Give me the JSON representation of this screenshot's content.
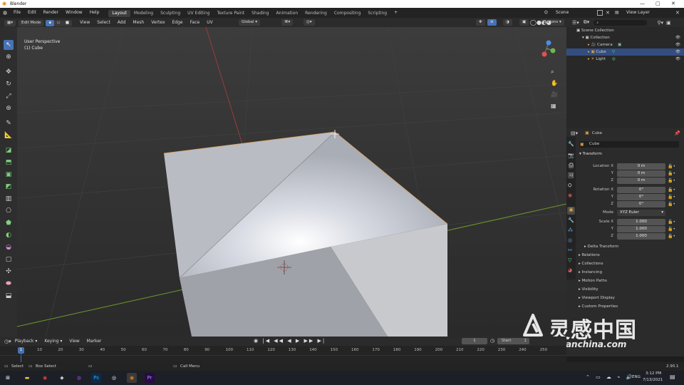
{
  "window": {
    "title": "Blender"
  },
  "menu": [
    "File",
    "Edit",
    "Render",
    "Window",
    "Help"
  ],
  "workspaces": [
    "Layout",
    "Modeling",
    "Sculpting",
    "UV Editing",
    "Texture Paint",
    "Shading",
    "Animation",
    "Rendering",
    "Compositing",
    "Scripting"
  ],
  "active_workspace": "Layout",
  "scene": {
    "label": "Scene",
    "view_layer": "View Layer"
  },
  "header": {
    "mode": "Edit Mode",
    "menus": [
      "View",
      "Select",
      "Add",
      "Mesh",
      "Vertex",
      "Edge",
      "Face",
      "UV"
    ],
    "orientation": "Global",
    "options": "Options"
  },
  "viewport": {
    "perspective": "User Perspective",
    "object": "(1) Cube"
  },
  "outliner": {
    "root": "Scene Collection",
    "collection": "Collection",
    "items": [
      "Camera",
      "Cube",
      "Light"
    ],
    "selected": "Cube",
    "search_placeholder": ""
  },
  "properties": {
    "object_name": "Cube",
    "data_name": "Cube",
    "transform_title": "Transform",
    "location": {
      "label": "Location X",
      "y": "Y",
      "z": "Z",
      "values": [
        "0 m",
        "0 m",
        "0 m"
      ]
    },
    "rotation": {
      "label": "Rotation X",
      "y": "Y",
      "z": "Z",
      "values": [
        "0°",
        "0°",
        "0°"
      ]
    },
    "mode": {
      "label": "Mode",
      "value": "XYZ Euler"
    },
    "scale": {
      "label": "Scale X",
      "y": "Y",
      "z": "Z",
      "values": [
        "1.000",
        "1.000",
        "1.000"
      ]
    },
    "delta": "Delta Transform",
    "panels": [
      "Relations",
      "Collections",
      "Instancing",
      "Motion Paths",
      "Visibility",
      "Viewport Display",
      "Custom Properties"
    ]
  },
  "timeline": {
    "menus": [
      "Playback",
      "Keying",
      "View",
      "Marker"
    ],
    "current_frame": "1",
    "start_label": "Start",
    "start_value": "1",
    "ticks": [
      "10",
      "20",
      "30",
      "40",
      "50",
      "60",
      "70",
      "80",
      "90",
      "100",
      "110",
      "120",
      "130",
      "140",
      "150",
      "160",
      "170",
      "180",
      "190",
      "200",
      "210",
      "220",
      "230",
      "240",
      "250"
    ]
  },
  "status": {
    "select": "Select",
    "box_select": "Box Select",
    "call_menu": "Call Menu",
    "version": "2.90.1"
  },
  "taskbar": {
    "lang": "ENG",
    "time": "3:12 PM",
    "date": "7/13/2021"
  },
  "watermark": {
    "text": "灵感中国",
    "url": "lingganchina.com"
  },
  "colors": {
    "accent": "#4772b3",
    "selected_row": "#334d80",
    "viewport_bg": "#393939"
  }
}
